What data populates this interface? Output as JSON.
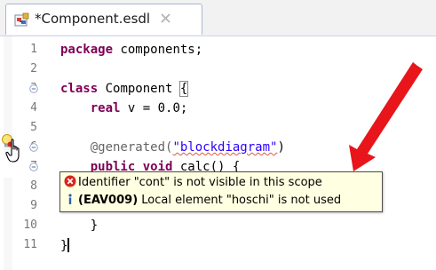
{
  "tab": {
    "title": "*Component.esdl",
    "close_glyph": "✕"
  },
  "editor": {
    "lines": [
      {
        "number": "1",
        "segments": [
          {
            "t": "package",
            "c": "kw"
          },
          {
            "t": " components;",
            "c": ""
          }
        ]
      },
      {
        "number": "2",
        "segments": []
      },
      {
        "number": "3",
        "segments": [
          {
            "t": "class",
            "c": "kw"
          },
          {
            "t": " Component ",
            "c": ""
          },
          {
            "t": "{",
            "c": "bracket-box"
          }
        ]
      },
      {
        "number": "4",
        "segments": [
          {
            "t": "    ",
            "c": ""
          },
          {
            "t": "real",
            "c": "kw"
          },
          {
            "t": " v = 0.0;",
            "c": ""
          }
        ]
      },
      {
        "number": "5",
        "segments": []
      },
      {
        "number": "6",
        "segments": [
          {
            "t": "    @generated(",
            "c": "ann"
          },
          {
            "t": "\"blockdiagram\"",
            "c": "str"
          },
          {
            "t": ")",
            "c": ""
          }
        ]
      },
      {
        "number": "7",
        "segments": [
          {
            "t": "    ",
            "c": ""
          },
          {
            "t": "public",
            "c": "kw"
          },
          {
            "t": " ",
            "c": ""
          },
          {
            "t": "void",
            "c": "kw"
          },
          {
            "t": " calc() {",
            "c": ""
          }
        ]
      },
      {
        "number": "8",
        "segments": []
      },
      {
        "number": "9",
        "segments": []
      },
      {
        "number": "10",
        "segments": [
          {
            "t": "    }",
            "c": ""
          }
        ]
      },
      {
        "number": "11",
        "segments": [
          {
            "t": "}",
            "c": ""
          }
        ]
      }
    ]
  },
  "tooltip": {
    "error_message": "Identifier \"cont\" is not visible in this scope",
    "info_code": "(EAV009)",
    "info_message": " Local element \"hoschi\" is not used"
  },
  "icons": {
    "tab": "esdl-file-icon",
    "close": "close-icon",
    "fold": "fold-collapse-icon",
    "bulb": "quick-fix-bulb-icon",
    "hand": "hand-pointer-icon",
    "error": "error-icon",
    "info": "info-icon"
  },
  "colors": {
    "keyword": "#7f0055",
    "string": "#2a00ff",
    "annotation": "#646464",
    "tooltip_bg": "#ffffe1",
    "arrow": "#e8151b"
  }
}
